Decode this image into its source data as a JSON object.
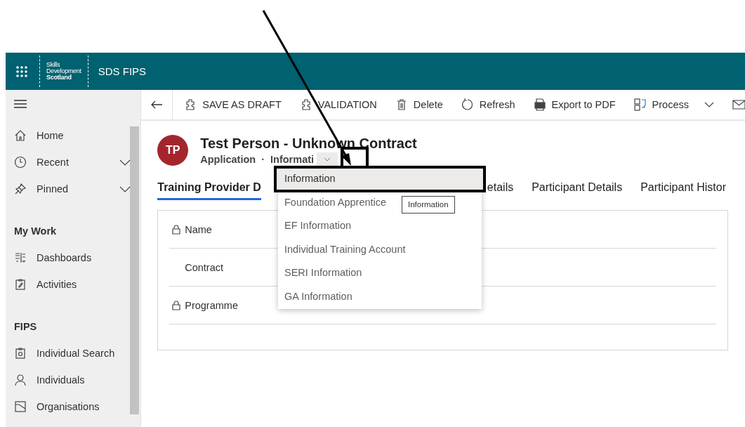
{
  "app_bar": {
    "brand_lines": [
      "Skills",
      "Development",
      "Scotland"
    ],
    "app_name": "SDS FIPS"
  },
  "sidebar": {
    "items": [
      {
        "kind": "item",
        "label": "Home",
        "expandable": false
      },
      {
        "kind": "item",
        "label": "Recent",
        "expandable": true
      },
      {
        "kind": "item",
        "label": "Pinned",
        "expandable": true
      },
      {
        "kind": "header",
        "label": "My Work"
      },
      {
        "kind": "item",
        "label": "Dashboards",
        "expandable": false
      },
      {
        "kind": "item",
        "label": "Activities",
        "expandable": false
      },
      {
        "kind": "header",
        "label": "FIPS"
      },
      {
        "kind": "item",
        "label": "Individual Search",
        "expandable": false
      },
      {
        "kind": "item",
        "label": "Individuals",
        "expandable": false
      },
      {
        "kind": "item",
        "label": "Organisations",
        "expandable": false
      }
    ]
  },
  "toolbar": {
    "buttons": [
      {
        "label": "SAVE AS DRAFT",
        "has_menu": false
      },
      {
        "label": "VALIDATION",
        "has_menu": false
      },
      {
        "label": "Delete",
        "has_menu": false
      },
      {
        "label": "Refresh",
        "has_menu": false
      },
      {
        "label": "Export to PDF",
        "has_menu": false
      },
      {
        "label": "Process",
        "has_menu": true
      }
    ]
  },
  "record": {
    "initials": "TP",
    "title": "Test Person - Unknown Contract",
    "entity": "Application",
    "separator": "·",
    "form": "Informati"
  },
  "tabs": [
    {
      "label": "Training Provider D",
      "selected": true
    },
    {
      "label": "etails",
      "selected": false
    },
    {
      "label": "Participant Details",
      "selected": false
    },
    {
      "label": "Participant Histor",
      "selected": false
    }
  ],
  "fields": [
    {
      "label": "Name",
      "locked": true
    },
    {
      "label": "Contract",
      "locked": false
    },
    {
      "label": "Programme",
      "locked": true
    }
  ],
  "form_menu": {
    "items": [
      {
        "label": "Information",
        "selected": true
      },
      {
        "label": "Foundation Apprentice",
        "selected": false
      },
      {
        "label": "EF Information",
        "selected": false
      },
      {
        "label": "Individual Training Account",
        "selected": false
      },
      {
        "label": "SERI Information",
        "selected": false
      },
      {
        "label": "GA Information",
        "selected": false
      }
    ],
    "tooltip": "Information"
  },
  "annotations": [
    {
      "kind": "arrow"
    },
    {
      "kind": "box"
    },
    {
      "kind": "box"
    }
  ]
}
